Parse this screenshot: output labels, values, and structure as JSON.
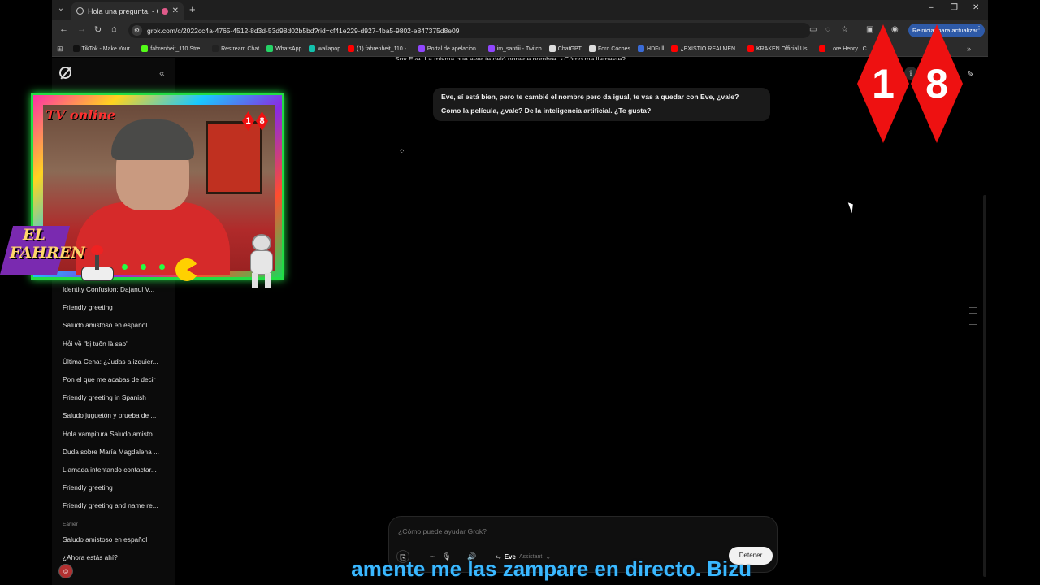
{
  "browser": {
    "tab_title": "Hola una pregunta. - Grok",
    "url": "grok.com/c/2022cc4a-4765-4512-8d3d-53d98d02b5bd?rid=cf41e229-d927-4ba5-9802-e847375d8e09",
    "update_button": "Reiniciar para actualizar",
    "bookmarks": [
      {
        "label": "TikTok - Make Your...",
        "color": "#111111"
      },
      {
        "label": "fahrenheit_110 Stre...",
        "color": "#53fc18"
      },
      {
        "label": "Restream Chat",
        "color": "#222222"
      },
      {
        "label": "WhatsApp",
        "color": "#25d366"
      },
      {
        "label": "wallapop",
        "color": "#13c1ac"
      },
      {
        "label": "(1) fahrenheit_110 -...",
        "color": "#ff0000"
      },
      {
        "label": "Portal de apelacion...",
        "color": "#9146ff"
      },
      {
        "label": "im_santiii - Twitch",
        "color": "#9146ff"
      },
      {
        "label": "ChatGPT",
        "color": "#dddddd"
      },
      {
        "label": "Foro Coches",
        "color": "#dddddd"
      },
      {
        "label": "HDFull",
        "color": "#3a6bd6"
      },
      {
        "label": "¿EXISTIÓ REALMEN...",
        "color": "#ff0000"
      },
      {
        "label": "KRAKEN Official Us...",
        "color": "#ff0000"
      },
      {
        "label": "...ore Henry | C...",
        "color": "#ff0000"
      }
    ]
  },
  "sidebar": {
    "history": [
      "Identity Confusion: Dajanul V...",
      "Friendly greeting",
      "Saludo amistoso en español",
      "Hỏi về \"bị tuôn là sao\"",
      "Última Cena: ¿Judas a izquier...",
      "Pon el que me acabas de decir",
      "Friendly greeting in Spanish",
      "Saludo juguetón y prueba de ...",
      "Hola vampitura Saludo amisto...",
      "Duda sobre María Magdalena ...",
      "Llamada intentando contactar...",
      "Friendly greeting",
      "Friendly greeting and name re..."
    ],
    "section_earlier": "Earlier",
    "history_earlier": [
      "Saludo amistoso en español",
      "¿Ahora estás ahí?"
    ]
  },
  "chat": {
    "previous_line": "Soy Eve. La misma que ayer te dejó ponerle nombre. ¿Cómo me llamaste?",
    "user_message_line1": "Eve, sí está bien, pero te cambié el nombre pero da igual, te vas a quedar con Eve, ¿vale?",
    "user_message_line2": "Como la película, ¿vale? De la inteligencia artificial. ¿Te gusta?"
  },
  "composer": {
    "placeholder": "¿Cómo puede ayudar Grok?",
    "mode_name": "Eve",
    "mode_sub": "Assistant",
    "stop_label": "Detener"
  },
  "overlay": {
    "cam_badge": "TV online",
    "logo_line1": "EL",
    "logo_line2": "FAHREN",
    "age_digit1": "1",
    "age_digit2": "8",
    "ticker_text": "amente me las zampare en directo. Bizu"
  }
}
